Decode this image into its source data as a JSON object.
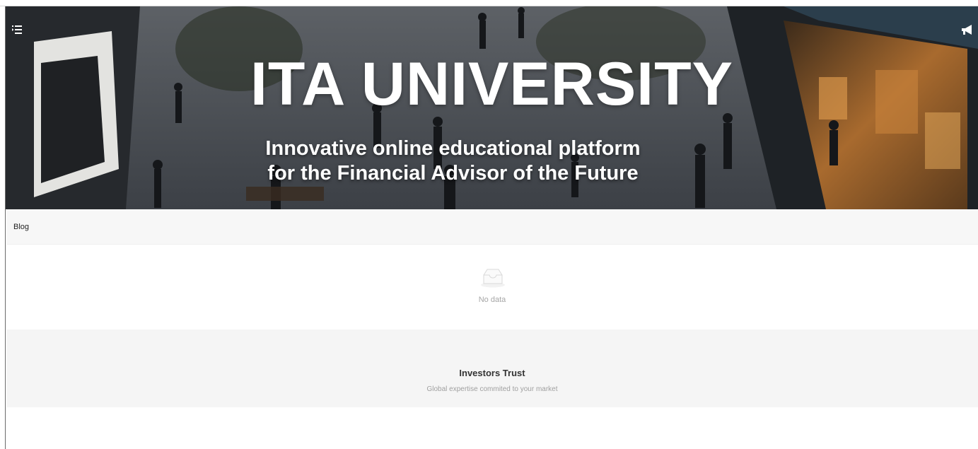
{
  "hero": {
    "title": "ITA UNIVERSITY",
    "subtitle_line1": "Innovative online educational platform",
    "subtitle_line2": "for the Financial Advisor of the Future",
    "menu_icon": "menu-list-icon",
    "announce_icon": "megaphone-icon"
  },
  "blog": {
    "label": "Blog",
    "empty_text": "No data",
    "empty_icon": "empty-inbox-icon"
  },
  "footer": {
    "title": "Investors Trust",
    "tagline": "Global expertise commited to your market"
  },
  "colors": {
    "band_background": "#f5f5f5",
    "muted_text": "#a6a6a6",
    "hero_text": "#ffffff"
  }
}
